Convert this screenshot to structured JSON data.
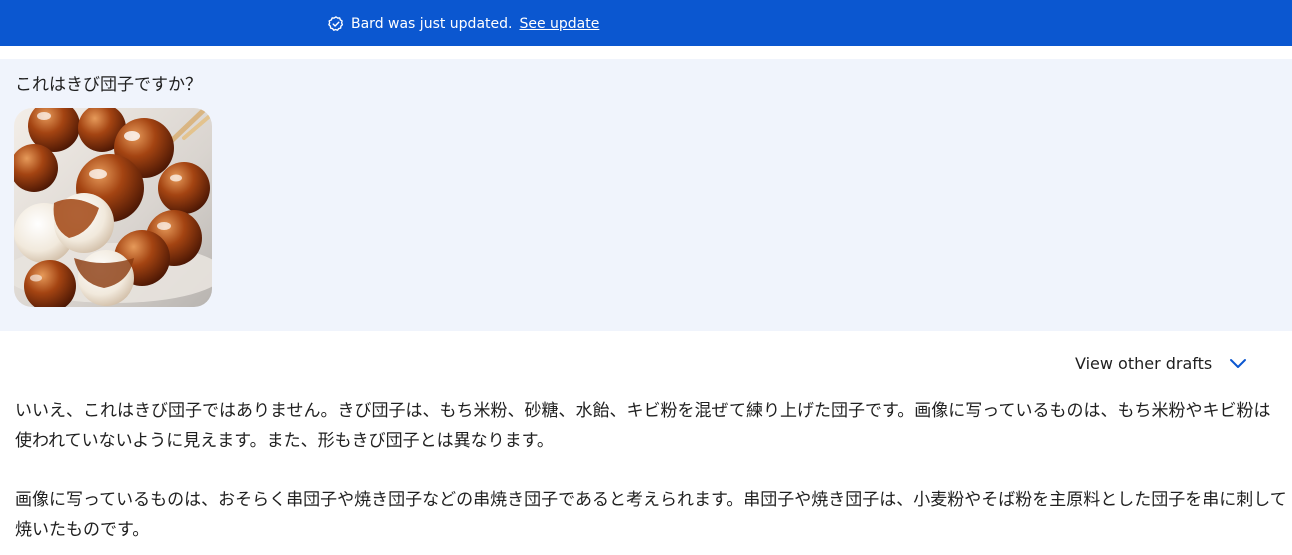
{
  "banner": {
    "icon": "verified-check-icon",
    "message": "Bard was just updated.",
    "link_label": "See update",
    "bg_color": "#0b57d0"
  },
  "query": {
    "text": "これはきび団子ですか？",
    "bg_color": "#f0f4fc",
    "image_description": "dango-skewers-image"
  },
  "response": {
    "drafts_label": "View other drafts",
    "drafts_icon": "chevron-down-icon",
    "paragraphs": [
      "いいえ、これはきび団子ではありません。きび団子は、もち米粉、砂糖、水飴、キビ粉を混ぜて練り上げた団子です。画像に写っているものは、もち米粉やキビ粉は使われていないように見えます。また、形もきび団子とは異なります。",
      "画像に写っているものは、おそらく串団子や焼き団子などの串焼き団子であると考えられます。串団子や焼き団子は、小麦粉やそば粉を主原料とした団子を串に刺して焼いたものです。"
    ]
  }
}
